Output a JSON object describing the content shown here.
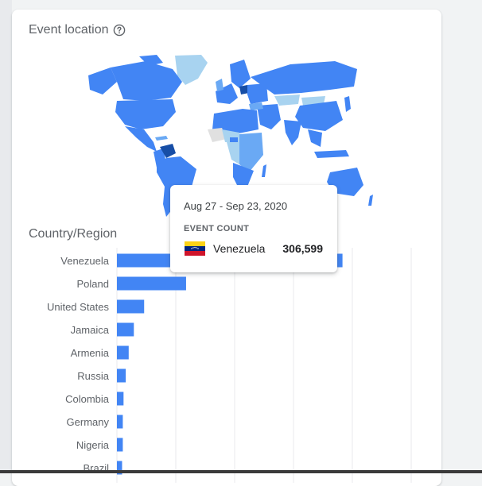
{
  "card": {
    "title": "Event location",
    "help_icon": "help-circle-icon",
    "section_title": "Country/Region"
  },
  "colors": {
    "bar": "#4285f4",
    "map_top": "#174ea6",
    "map_high": "#4285f4",
    "map_mid": "#6aa9f4",
    "map_low": "#a8d3f0",
    "map_none": "#e0e0e0",
    "grid": "#e8eaed"
  },
  "tooltip": {
    "date_range": "Aug 27 - Sep 23, 2020",
    "metric_label": "EVENT COUNT",
    "country": "Venezuela",
    "value": "306,599",
    "flag_icon": "venezuela-flag-icon"
  },
  "chart_data": {
    "type": "bar",
    "orientation": "horizontal",
    "categories": [
      "Venezuela",
      "Poland",
      "United States",
      "Jamaica",
      "Armenia",
      "Russia",
      "Colombia",
      "Germany",
      "Nigeria",
      "Brazil"
    ],
    "values": [
      306599,
      94000,
      37000,
      23000,
      16000,
      12000,
      9000,
      8000,
      8000,
      7000
    ],
    "xlim": [
      0,
      400000
    ],
    "grid": true,
    "x_tick_labels_visible": false
  }
}
